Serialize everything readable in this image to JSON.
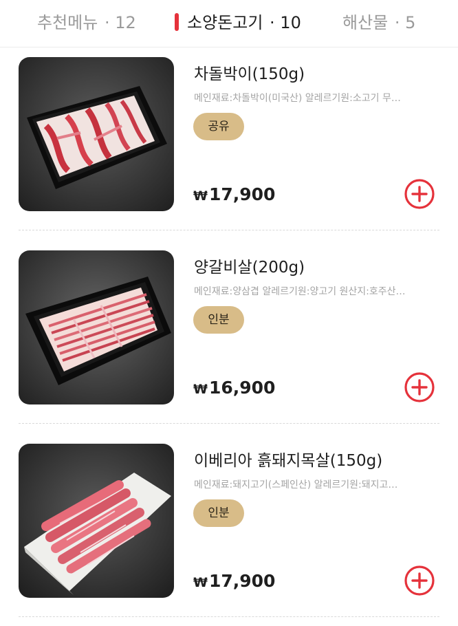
{
  "category_tabs": [
    {
      "label": "추천메뉴",
      "count": "· 12",
      "active": false
    },
    {
      "label": "소양돈고기",
      "count": "· 10",
      "active": true
    },
    {
      "label": "해산물",
      "count": "· 5",
      "active": false
    }
  ],
  "colors": {
    "accent": "#e5323b",
    "tag_bg": "#d8bc88",
    "text_main": "#1f1f1f",
    "text_muted": "#a4a4a4"
  },
  "menu_items": [
    {
      "name": "차돌박이(150g)",
      "description": "메인재료:차돌박이(미국산) 알레르기원:소고기 무…",
      "tag": "공유",
      "currency": "₩",
      "price": "17,900",
      "add_icon": "plus-circle-icon"
    },
    {
      "name": "양갈비살(200g)",
      "description": "메인재료:양삼겹 알레르기원:양고기 원산지:호주산…",
      "tag": "인분",
      "currency": "₩",
      "price": "16,900",
      "add_icon": "plus-circle-icon"
    },
    {
      "name": "이베리아 흙돼지목살(150g)",
      "description": "메인재료:돼지고기(스페인산) 알레르기원:돼지고…",
      "tag": "인분",
      "currency": "₩",
      "price": "17,900",
      "add_icon": "plus-circle-icon"
    }
  ]
}
